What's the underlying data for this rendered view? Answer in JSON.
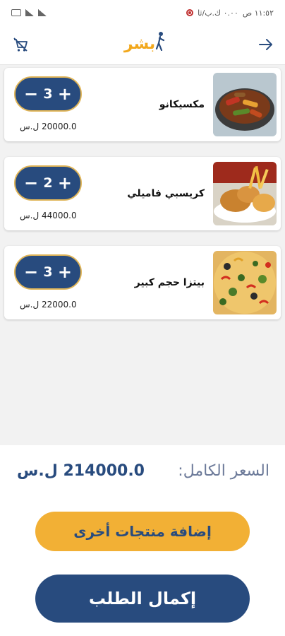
{
  "statusbar": {
    "time": "١١:٥٢ ص",
    "notice": "٠.٠٠ ك.ب/ثا"
  },
  "header": {
    "logo_text": "بشر"
  },
  "cart": {
    "items": [
      {
        "name": "مكسيكانو",
        "quantity": "3",
        "price": "20000.0 ل.س",
        "image": "fajita-skillet"
      },
      {
        "name": "كريسبي فاميلي",
        "quantity": "2",
        "price": "44000.0 ل.س",
        "image": "crispy-chicken-fries"
      },
      {
        "name": "بيتزا حجم كبير",
        "quantity": "3",
        "price": "22000.0 ل.س",
        "image": "large-pizza"
      }
    ],
    "stepper_minus": "−",
    "stepper_plus": "+"
  },
  "summary": {
    "total_label": "السعر الكامل:",
    "total_value": "214000.0 ل.س"
  },
  "actions": {
    "add_more": "إضافة منتجات أخرى",
    "complete_order": "إكمال الطلب"
  },
  "colors": {
    "primary": "#284b7e",
    "accent": "#f2b035",
    "logo": "#f2a81d"
  }
}
